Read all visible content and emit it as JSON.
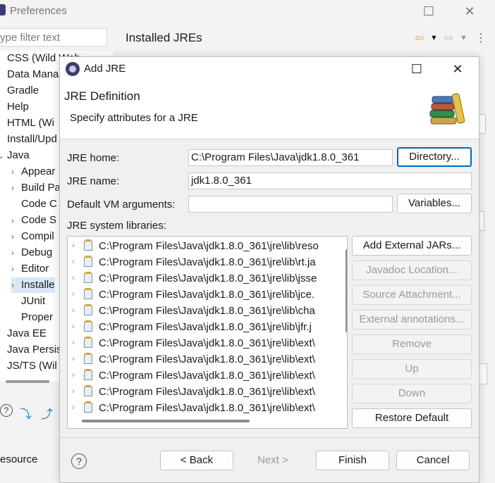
{
  "preferences": {
    "title": "Preferences",
    "filter_placeholder": "ype filter text",
    "header_title": "Installed JREs",
    "tree": [
      {
        "label": "CSS (Wild Web",
        "arrow": ">",
        "indent": 0
      },
      {
        "label": "Data Mana",
        "arrow": ">",
        "indent": 0
      },
      {
        "label": "Gradle",
        "arrow": ">",
        "indent": 0
      },
      {
        "label": "Help",
        "arrow": ">",
        "indent": 0
      },
      {
        "label": "HTML (Wi",
        "arrow": ">",
        "indent": 0
      },
      {
        "label": "Install/Upd",
        "arrow": ">",
        "indent": 0
      },
      {
        "label": "Java",
        "arrow": "v",
        "indent": 0
      },
      {
        "label": "Appear",
        "arrow": ">",
        "indent": 1
      },
      {
        "label": "Build Pa",
        "arrow": ">",
        "indent": 1
      },
      {
        "label": "Code C",
        "arrow": "",
        "indent": 1
      },
      {
        "label": "Code S",
        "arrow": ">",
        "indent": 1
      },
      {
        "label": "Compil",
        "arrow": ">",
        "indent": 1
      },
      {
        "label": "Debug",
        "arrow": ">",
        "indent": 1
      },
      {
        "label": "Editor",
        "arrow": ">",
        "indent": 1
      },
      {
        "label": "Installe",
        "arrow": ">",
        "indent": 1,
        "selected": true
      },
      {
        "label": "JUnit",
        "arrow": "",
        "indent": 1
      },
      {
        "label": "Proper",
        "arrow": "",
        "indent": 1
      },
      {
        "label": "Java EE",
        "arrow": ">",
        "indent": 0
      },
      {
        "label": "Java Persis",
        "arrow": ">",
        "indent": 0
      },
      {
        "label": "JS/TS (Wil",
        "arrow": ">",
        "indent": 0
      }
    ],
    "bottom_left_text": "esource"
  },
  "dialog": {
    "title": "Add JRE",
    "heading": "JRE Definition",
    "subheading": "Specify attributes for a JRE",
    "jre_home_label": "JRE home:",
    "jre_home_value": "C:\\Program Files\\Java\\jdk1.8.0_361",
    "jre_name_label": "JRE name:",
    "jre_name_value": "jdk1.8.0_361",
    "vm_args_label": "Default VM arguments:",
    "vm_args_value": "",
    "libraries_label": "JRE system libraries:",
    "libraries": [
      "C:\\Program Files\\Java\\jdk1.8.0_361\\jre\\lib\\reso",
      "C:\\Program Files\\Java\\jdk1.8.0_361\\jre\\lib\\rt.ja",
      "C:\\Program Files\\Java\\jdk1.8.0_361\\jre\\lib\\jsse",
      "C:\\Program Files\\Java\\jdk1.8.0_361\\jre\\lib\\jce.",
      "C:\\Program Files\\Java\\jdk1.8.0_361\\jre\\lib\\cha",
      "C:\\Program Files\\Java\\jdk1.8.0_361\\jre\\lib\\jfr.j",
      "C:\\Program Files\\Java\\jdk1.8.0_361\\jre\\lib\\ext\\",
      "C:\\Program Files\\Java\\jdk1.8.0_361\\jre\\lib\\ext\\",
      "C:\\Program Files\\Java\\jdk1.8.0_361\\jre\\lib\\ext\\",
      "C:\\Program Files\\Java\\jdk1.8.0_361\\jre\\lib\\ext\\",
      "C:\\Program Files\\Java\\jdk1.8.0_361\\jre\\lib\\ext\\"
    ],
    "buttons": {
      "directory": "Directory...",
      "variables": "Variables...",
      "add_external_jars": "Add External JARs...",
      "javadoc_location": "Javadoc Location...",
      "source_attachment": "Source Attachment...",
      "external_annotations": "External annotations...",
      "remove": "Remove",
      "up": "Up",
      "down": "Down",
      "restore_default": "Restore Default",
      "back": "< Back",
      "next": "Next >",
      "finish": "Finish",
      "cancel": "Cancel"
    }
  }
}
